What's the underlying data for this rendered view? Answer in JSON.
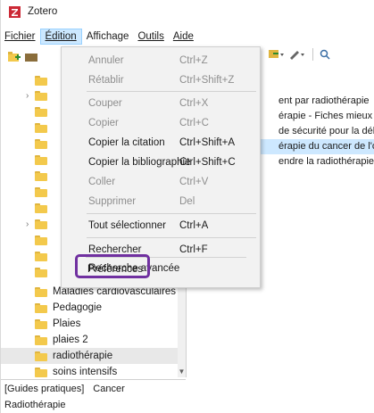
{
  "window": {
    "title": "Zotero",
    "accent": "#7030a0",
    "selection": "#cde8ff"
  },
  "menubar": {
    "items": [
      {
        "label": "Fichier",
        "underline_index": 0
      },
      {
        "label": "Édition",
        "underline_index": 0
      },
      {
        "label": "Affichage",
        "underline_index": 0
      },
      {
        "label": "Outils",
        "underline_index": 0
      },
      {
        "label": "Aide",
        "underline_index": 0
      }
    ]
  },
  "edit_menu": {
    "items": [
      {
        "label": "Annuler",
        "shortcut": "Ctrl+Z",
        "disabled": true
      },
      {
        "label": "Rétablir",
        "shortcut": "Ctrl+Shift+Z",
        "disabled": true
      },
      {
        "label": "Couper",
        "shortcut": "Ctrl+X",
        "disabled": true
      },
      {
        "label": "Copier",
        "shortcut": "Ctrl+C",
        "disabled": true
      },
      {
        "label": "Copier la citation",
        "shortcut": "Ctrl+Shift+A",
        "disabled": false
      },
      {
        "label": "Copier la bibliographie",
        "shortcut": "Ctrl+Shift+C",
        "disabled": false
      },
      {
        "label": "Coller",
        "shortcut": "Ctrl+V",
        "disabled": true
      },
      {
        "label": "Supprimer",
        "shortcut": "Del",
        "disabled": true
      },
      {
        "label": "Tout sélectionner",
        "shortcut": "Ctrl+A",
        "disabled": false
      },
      {
        "label": "Rechercher",
        "shortcut": "Ctrl+F",
        "disabled": false
      },
      {
        "label": "Recherche avancée",
        "shortcut": "",
        "disabled": false
      },
      {
        "label": "Préférences",
        "shortcut": "",
        "disabled": false
      }
    ]
  },
  "collections": [
    {
      "label": "Maladies cardiovasculaires"
    },
    {
      "label": "Pedagogie"
    },
    {
      "label": "Plaies"
    },
    {
      "label": "plaies 2"
    },
    {
      "label": "radiothérapie"
    },
    {
      "label": "soins intensifs"
    }
  ],
  "items": [
    {
      "title": "ent par radiothérapie"
    },
    {
      "title": "érapie - Fiches mieux vivre"
    },
    {
      "title": "de sécurité pour la délinéa"
    },
    {
      "title": "érapie du cancer de l'œsop"
    },
    {
      "title": "endre la radiothérapie"
    }
  ],
  "tags": [
    "[Guides pratiques]",
    "Cancer",
    "Radiothérapie"
  ]
}
